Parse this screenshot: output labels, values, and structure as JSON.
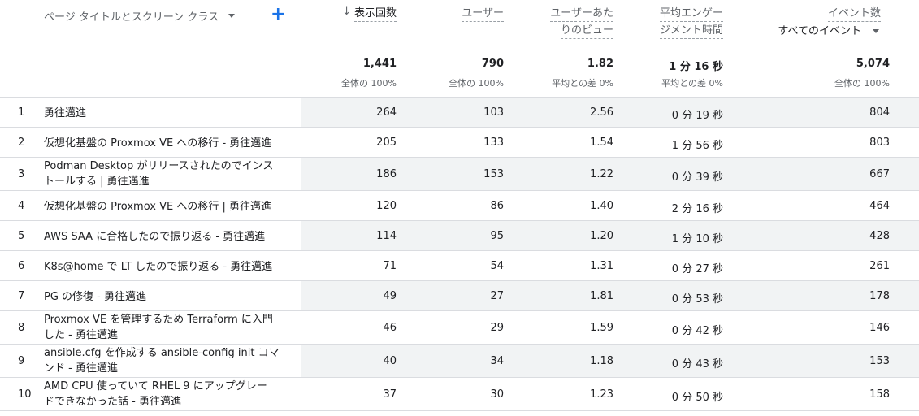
{
  "header": {
    "dimension_label": "ページ タイトルとスクリーン クラス",
    "columns": [
      {
        "label_line1": "表示回数",
        "label_line2": ""
      },
      {
        "label_line1": "ユーザー",
        "label_line2": ""
      },
      {
        "label_line1": "ユーザーあた",
        "label_line2": "りのビュー"
      },
      {
        "label_line1": "平均エンゲー",
        "label_line2": "ジメント時間"
      },
      {
        "label_line1": "イベント数",
        "label_line2": "すべてのイベント"
      }
    ]
  },
  "totals": [
    {
      "value": "1,441",
      "sub": "全体の 100%"
    },
    {
      "value": "790",
      "sub": "全体の 100%"
    },
    {
      "value": "1.82",
      "sub": "平均との差 0%"
    },
    {
      "value": "1 分 16 秒",
      "sub": "平均との差 0%"
    },
    {
      "value": "5,074",
      "sub": "全体の 100%"
    }
  ],
  "rows": [
    {
      "idx": "1",
      "title_1": "勇往邁進",
      "title_2": "",
      "views": "264",
      "users": "103",
      "vpu": "2.56",
      "eng": "0 分 19 秒",
      "events": "804"
    },
    {
      "idx": "2",
      "title_1": "仮想化基盤の Proxmox VE への移行 - 勇往邁進",
      "title_2": "",
      "views": "205",
      "users": "133",
      "vpu": "1.54",
      "eng": "1 分 56 秒",
      "events": "803"
    },
    {
      "idx": "3",
      "title_1": "Podman Desktop がリリースされたのでインス",
      "title_2": "トールする | 勇往邁進",
      "views": "186",
      "users": "153",
      "vpu": "1.22",
      "eng": "0 分 39 秒",
      "events": "667"
    },
    {
      "idx": "4",
      "title_1": "仮想化基盤の Proxmox VE への移行 | 勇往邁進",
      "title_2": "",
      "views": "120",
      "users": "86",
      "vpu": "1.40",
      "eng": "2 分 16 秒",
      "events": "464"
    },
    {
      "idx": "5",
      "title_1": "AWS SAA に合格したので振り返る - 勇往邁進",
      "title_2": "",
      "views": "114",
      "users": "95",
      "vpu": "1.20",
      "eng": "1 分 10 秒",
      "events": "428"
    },
    {
      "idx": "6",
      "title_1": "K8s@home で LT したので振り返る - 勇往邁進",
      "title_2": "",
      "views": "71",
      "users": "54",
      "vpu": "1.31",
      "eng": "0 分 27 秒",
      "events": "261"
    },
    {
      "idx": "7",
      "title_1": "PG の修復 - 勇往邁進",
      "title_2": "",
      "views": "49",
      "users": "27",
      "vpu": "1.81",
      "eng": "0 分 53 秒",
      "events": "178"
    },
    {
      "idx": "8",
      "title_1": "Proxmox VE を管理するため Terraform に入門",
      "title_2": "した - 勇往邁進",
      "views": "46",
      "users": "29",
      "vpu": "1.59",
      "eng": "0 分 42 秒",
      "events": "146"
    },
    {
      "idx": "9",
      "title_1": "ansible.cfg を作成する ansible-config init コマ",
      "title_2": "ンド - 勇往邁進",
      "views": "40",
      "users": "34",
      "vpu": "1.18",
      "eng": "0 分 43 秒",
      "events": "153"
    },
    {
      "idx": "10",
      "title_1": "AMD CPU 使っていて RHEL 9 にアップグレー",
      "title_2": "ドできなかった話 - 勇往邁進",
      "views": "37",
      "users": "30",
      "vpu": "1.23",
      "eng": "0 分 50 秒",
      "events": "158"
    }
  ]
}
